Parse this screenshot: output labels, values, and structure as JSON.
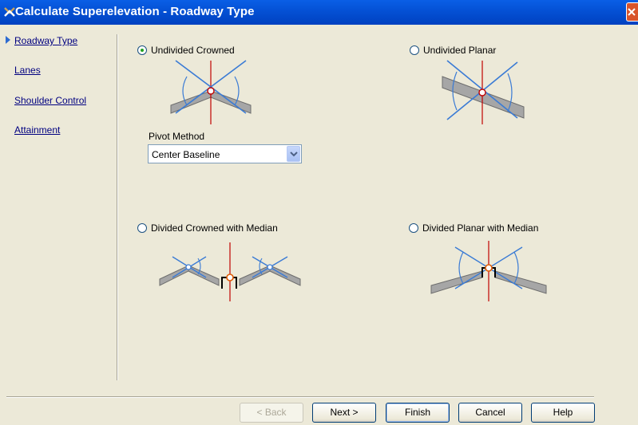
{
  "window": {
    "title": "Calculate Superelevation - Roadway Type"
  },
  "nav": {
    "items": [
      {
        "label": "Roadway Type"
      },
      {
        "label": "Lanes"
      },
      {
        "label": "Shoulder Control"
      },
      {
        "label": "Attainment"
      }
    ]
  },
  "options": {
    "undivided_crowned": {
      "label": "Undivided Crowned",
      "selected": true
    },
    "undivided_planar": {
      "label": "Undivided Planar",
      "selected": false
    },
    "divided_crowned": {
      "label": "Divided Crowned with Median",
      "selected": false
    },
    "divided_planar": {
      "label": "Divided Planar with Median",
      "selected": false
    }
  },
  "pivot": {
    "label": "Pivot Method",
    "value": "Center Baseline"
  },
  "buttons": {
    "back": "< Back",
    "next": "Next >",
    "finish": "Finish",
    "cancel": "Cancel",
    "help": "Help"
  },
  "colors": {
    "titlebar": "#0450d4",
    "diagram_line": "#3a7bd5",
    "axis": "#c00000",
    "slab": "#a6a6a6"
  },
  "icons": [
    "app-icon",
    "close-icon",
    "current-page-marker-icon",
    "chevron-down-icon"
  ]
}
